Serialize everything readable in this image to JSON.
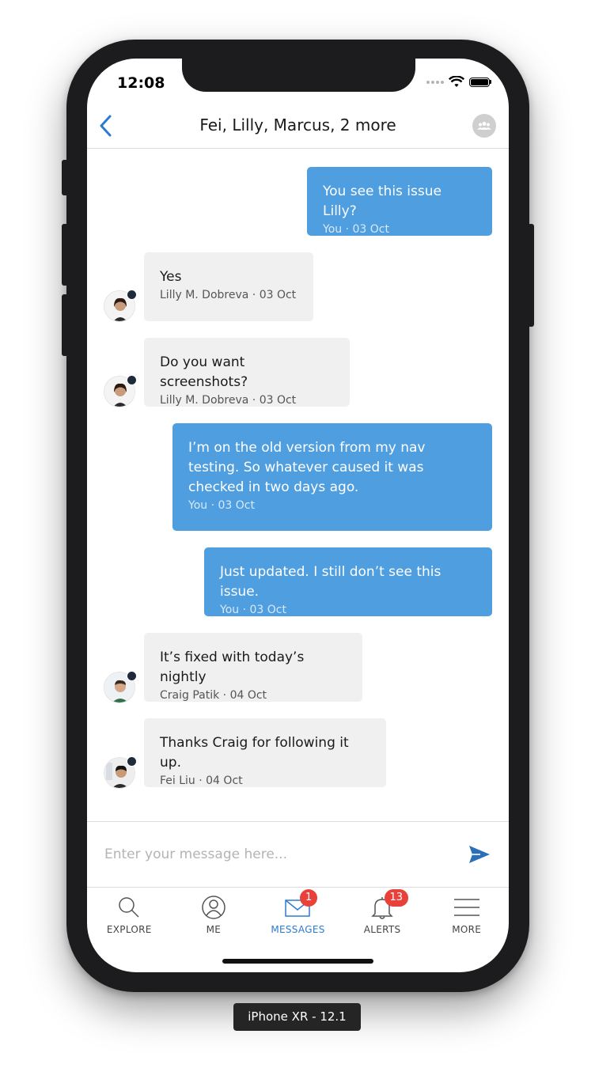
{
  "status_bar": {
    "time": "12:08"
  },
  "header": {
    "title": "Fei, Lilly, Marcus, 2 more"
  },
  "messages": [
    {
      "text": "You see this issue Lilly?",
      "meta": "You · 03 Oct",
      "direction": "outgoing"
    },
    {
      "text": "Yes",
      "meta": "Lilly M. Dobreva · 03 Oct",
      "direction": "incoming"
    },
    {
      "text": "Do you want screenshots?",
      "meta": "Lilly M. Dobreva · 03 Oct",
      "direction": "incoming"
    },
    {
      "text": "I’m on the old version from my nav testing. So whatever caused it was checked in two days ago.",
      "meta": "You · 03 Oct",
      "direction": "outgoing"
    },
    {
      "text": "Just updated. I still don’t see this issue.",
      "meta": "You · 03 Oct",
      "direction": "outgoing"
    },
    {
      "text": "It’s fixed with today’s nightly",
      "meta": "Craig Patik · 04 Oct",
      "direction": "incoming"
    },
    {
      "text": "Thanks Craig for following it up.",
      "meta": "Fei Liu · 04 Oct",
      "direction": "incoming"
    }
  ],
  "composer": {
    "placeholder": "Enter your message here..."
  },
  "tabs": [
    {
      "label": "EXPLORE",
      "icon": "search-icon"
    },
    {
      "label": "ME",
      "icon": "profile-icon"
    },
    {
      "label": "MESSAGES",
      "icon": "envelope-icon",
      "badge": "1",
      "active": true
    },
    {
      "label": "ALERTS",
      "icon": "bell-icon",
      "badge": "13"
    },
    {
      "label": "MORE",
      "icon": "menu-icon"
    }
  ],
  "device_label": "iPhone XR - 12.1",
  "colors": {
    "accent": "#2b7bd3",
    "outgoing_bubble": "#4f9ee0",
    "incoming_bubble": "#f0f0f0",
    "badge": "#e8413a"
  }
}
